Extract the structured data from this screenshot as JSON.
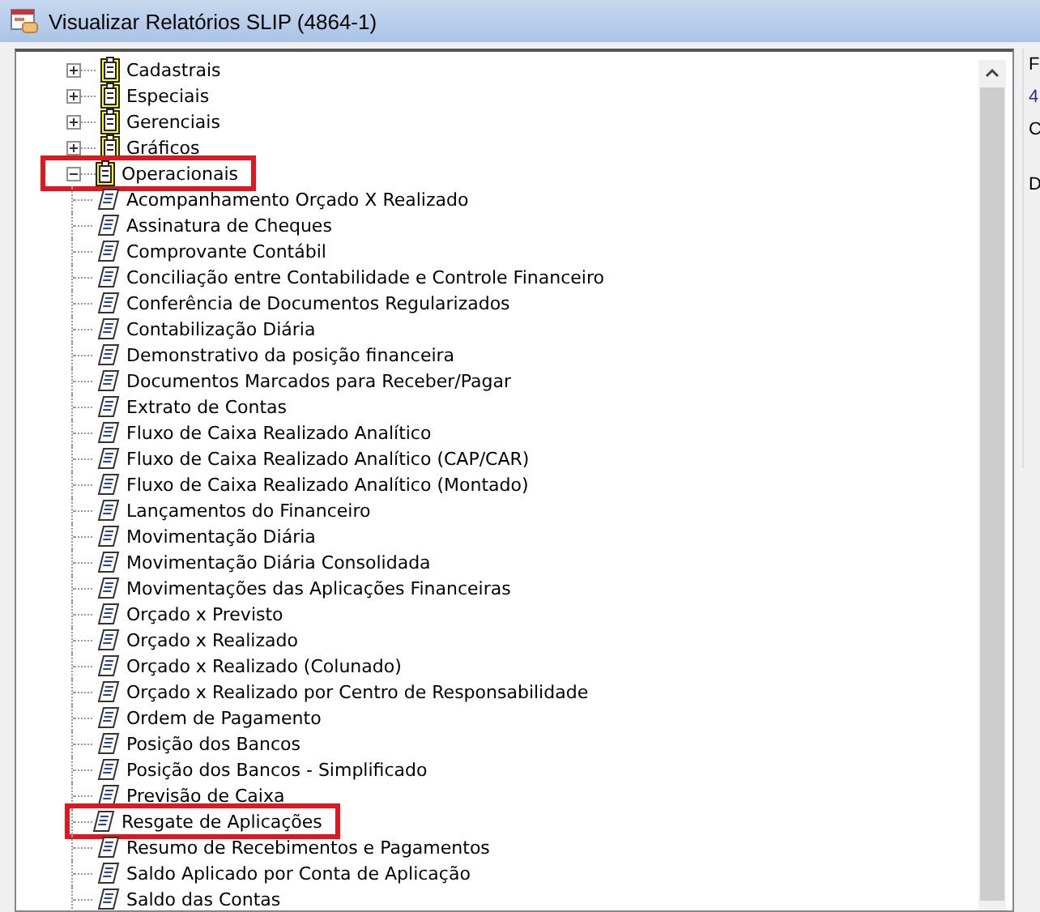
{
  "window": {
    "title": "Visualizar Relatórios SLIP (4864-1)"
  },
  "tree": [
    {
      "label": "Cadastrais",
      "expanded": false,
      "highlighted": false
    },
    {
      "label": "Especiais",
      "expanded": false,
      "highlighted": false
    },
    {
      "label": "Gerenciais",
      "expanded": false,
      "highlighted": false
    },
    {
      "label": "Gráficos",
      "expanded": false,
      "highlighted": false
    },
    {
      "label": "Operacionais",
      "expanded": true,
      "highlighted": true,
      "children": [
        {
          "label": "Acompanhamento Orçado X Realizado",
          "highlighted": false
        },
        {
          "label": "Assinatura de Cheques",
          "highlighted": false
        },
        {
          "label": "Comprovante Contábil",
          "highlighted": false
        },
        {
          "label": "Conciliação entre Contabilidade e Controle Financeiro",
          "highlighted": false
        },
        {
          "label": "Conferência de Documentos Regularizados",
          "highlighted": false
        },
        {
          "label": "Contabilização Diária",
          "highlighted": false
        },
        {
          "label": "Demonstrativo da posição financeira",
          "highlighted": false
        },
        {
          "label": "Documentos Marcados para Receber/Pagar",
          "highlighted": false
        },
        {
          "label": "Extrato de Contas",
          "highlighted": false
        },
        {
          "label": "Fluxo de Caixa Realizado Analítico",
          "highlighted": false
        },
        {
          "label": "Fluxo de Caixa Realizado Analítico (CAP/CAR)",
          "highlighted": false
        },
        {
          "label": "Fluxo de Caixa Realizado Analítico (Montado)",
          "highlighted": false
        },
        {
          "label": "Lançamentos do Financeiro",
          "highlighted": false
        },
        {
          "label": "Movimentação Diária",
          "highlighted": false
        },
        {
          "label": "Movimentação Diária Consolidada",
          "highlighted": false
        },
        {
          "label": "Movimentações das Aplicações Financeiras",
          "highlighted": false
        },
        {
          "label": "Orçado x Previsto",
          "highlighted": false
        },
        {
          "label": "Orçado x Realizado",
          "highlighted": false
        },
        {
          "label": "Orçado x Realizado (Colunado)",
          "highlighted": false
        },
        {
          "label": "Orçado x Realizado por Centro de Responsabilidade",
          "highlighted": false
        },
        {
          "label": "Ordem de Pagamento",
          "highlighted": false
        },
        {
          "label": "Posição dos Bancos",
          "highlighted": false
        },
        {
          "label": "Posição dos Bancos - Simplificado",
          "highlighted": false
        },
        {
          "label": "Previsão de Caixa",
          "highlighted": false
        },
        {
          "label": "Resgate de Aplicações",
          "highlighted": true
        },
        {
          "label": "Resumo de Recebimentos e Pagamentos",
          "highlighted": false
        },
        {
          "label": "Saldo Aplicado por Conta de Aplicação",
          "highlighted": false
        },
        {
          "label": "Saldo das Contas",
          "highlighted": false
        }
      ]
    }
  ],
  "side_panel": {
    "lines": [
      "F",
      "4",
      "C",
      "D"
    ]
  }
}
